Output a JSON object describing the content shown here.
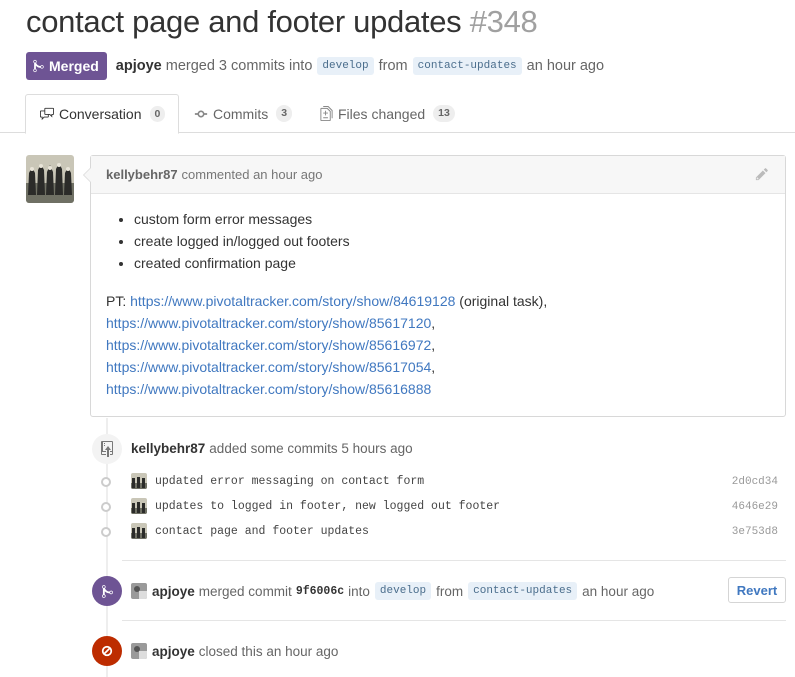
{
  "pr": {
    "title": "contact page and footer updates",
    "number": "#348",
    "state_label": "Merged",
    "author": "apjoye",
    "merged_text": "merged 3 commits into",
    "base_branch": "develop",
    "from_word": "from",
    "head_branch": "contact-updates",
    "time": "an hour ago"
  },
  "tabs": [
    {
      "label": "Conversation",
      "count": "0"
    },
    {
      "label": "Commits",
      "count": "3"
    },
    {
      "label": "Files changed",
      "count": "13"
    }
  ],
  "comment": {
    "author": "kellybehr87",
    "action": "commented an hour ago",
    "items": [
      "custom form error messages",
      "create logged in/logged out footers",
      "created confirmation page"
    ],
    "pt_prefix": "PT:",
    "links": [
      "https://www.pivotaltracker.com/story/show/84619128",
      "https://www.pivotaltracker.com/story/show/85617120",
      "https://www.pivotaltracker.com/story/show/85616972",
      "https://www.pivotaltracker.com/story/show/85617054",
      "https://www.pivotaltracker.com/story/show/85616888"
    ],
    "first_suffix": "(original task),",
    "comma": ","
  },
  "commits_event": {
    "author": "kellybehr87",
    "text": "added some commits 5 hours ago",
    "commits": [
      {
        "message": "updated error messaging on contact form",
        "sha": "2d0cd34"
      },
      {
        "message": "updates to logged in footer, new logged out footer",
        "sha": "4646e29"
      },
      {
        "message": "contact page and footer updates",
        "sha": "3e753d8"
      }
    ]
  },
  "merge_event": {
    "author": "apjoye",
    "text": "merged commit",
    "sha": "9f6006c",
    "into": "into",
    "base_branch": "develop",
    "from_word": "from",
    "head_branch": "contact-updates",
    "time": "an hour ago",
    "revert_label": "Revert"
  },
  "close_event": {
    "author": "apjoye",
    "text": "closed this an hour ago"
  },
  "colors": {
    "merged": "#6e5494",
    "closed": "#bd2c00",
    "link": "#4078c0"
  },
  "icons": [
    "git-merge-icon",
    "comment-discussion-icon",
    "git-commit-icon",
    "diff-icon",
    "pencil-icon",
    "repo-push-icon",
    "circle-slash-icon"
  ]
}
